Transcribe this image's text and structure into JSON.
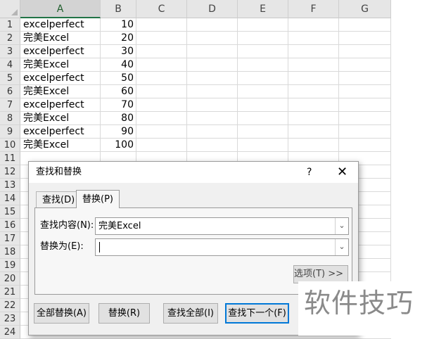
{
  "columns": [
    "A",
    "B",
    "C",
    "D",
    "E",
    "F",
    "G"
  ],
  "rows": [
    "1",
    "2",
    "3",
    "4",
    "5",
    "6",
    "7",
    "8",
    "9",
    "10",
    "11",
    "12",
    "13",
    "14",
    "15",
    "16",
    "17",
    "18",
    "19",
    "20",
    "21",
    "22",
    "23",
    "24"
  ],
  "cells": [
    {
      "a": "excelperfect",
      "b": "10"
    },
    {
      "a": "完美Excel",
      "b": "20"
    },
    {
      "a": "excelperfect",
      "b": "30"
    },
    {
      "a": "完美Excel",
      "b": "40"
    },
    {
      "a": "excelperfect",
      "b": "50"
    },
    {
      "a": "完美Excel",
      "b": "60"
    },
    {
      "a": "excelperfect",
      "b": "70"
    },
    {
      "a": "完美Excel",
      "b": "80"
    },
    {
      "a": "excelperfect",
      "b": "90"
    },
    {
      "a": "完美Excel",
      "b": "100"
    }
  ],
  "dialog": {
    "title": "查找和替换",
    "help": "?",
    "close": "✕",
    "tabs": {
      "find": "查找(D)",
      "replace": "替换(P)"
    },
    "find_label": "查找内容(N):",
    "find_value": "完美Excel",
    "replace_label": "替换为(E):",
    "replace_value": "",
    "options_label": "选项(T) >>",
    "buttons": {
      "replace_all": "全部替换(A)",
      "replace": "替换(R)",
      "find_all": "查找全部(I)",
      "find_next": "查找下一个(F)"
    },
    "dropdown_glyph": "⌄"
  },
  "watermark": "软件技巧"
}
